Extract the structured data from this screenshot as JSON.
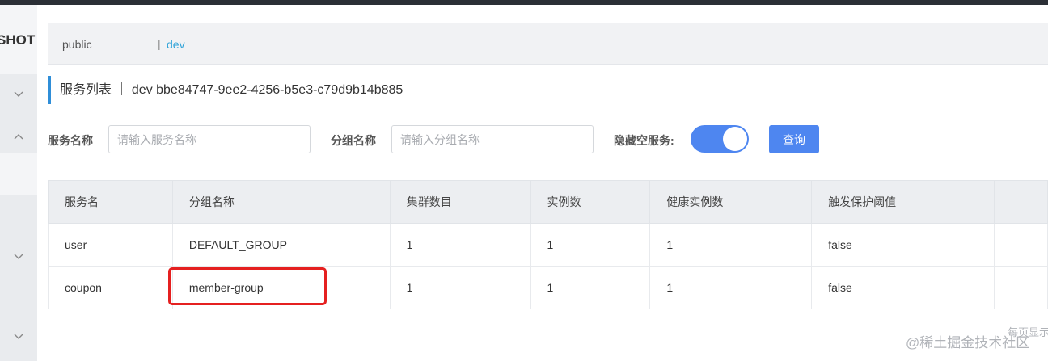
{
  "sidebar": {
    "brand": "SHOT",
    "chevrons": [
      "chevron-down-icon",
      "chevron-up-icon",
      "chevron-down-icon",
      "chevron-down-icon"
    ]
  },
  "namespaces": {
    "items": [
      "public",
      "dev"
    ],
    "separator": "|",
    "active": "dev",
    "active_color": "#2fa3d8"
  },
  "page": {
    "title": "服务列表 ｜ dev  bbe84747-9ee2-4256-b5e3-c79d9b14b885"
  },
  "filters": {
    "service_name_label": "服务名称",
    "service_name_placeholder": "请输入服务名称",
    "service_name_value": "",
    "group_name_label": "分组名称",
    "group_name_placeholder": "请输入分组名称",
    "group_name_value": "",
    "hide_empty_label": "隐藏空服务:",
    "hide_empty_on": true,
    "query_button": "查询",
    "accent": "#4e86f0"
  },
  "table": {
    "headers": [
      "服务名",
      "分组名称",
      "集群数目",
      "实例数",
      "健康实例数",
      "触发保护阈值",
      ""
    ],
    "rows": [
      [
        "user",
        "DEFAULT_GROUP",
        "1",
        "1",
        "1",
        "false",
        ""
      ],
      [
        "coupon",
        "member-group",
        "1",
        "1",
        "1",
        "false",
        ""
      ]
    ]
  },
  "annotation": {
    "highlight_color": "#e52020"
  },
  "watermark": {
    "text": "@稀土掘金技术社区",
    "partial": "每页显示"
  }
}
